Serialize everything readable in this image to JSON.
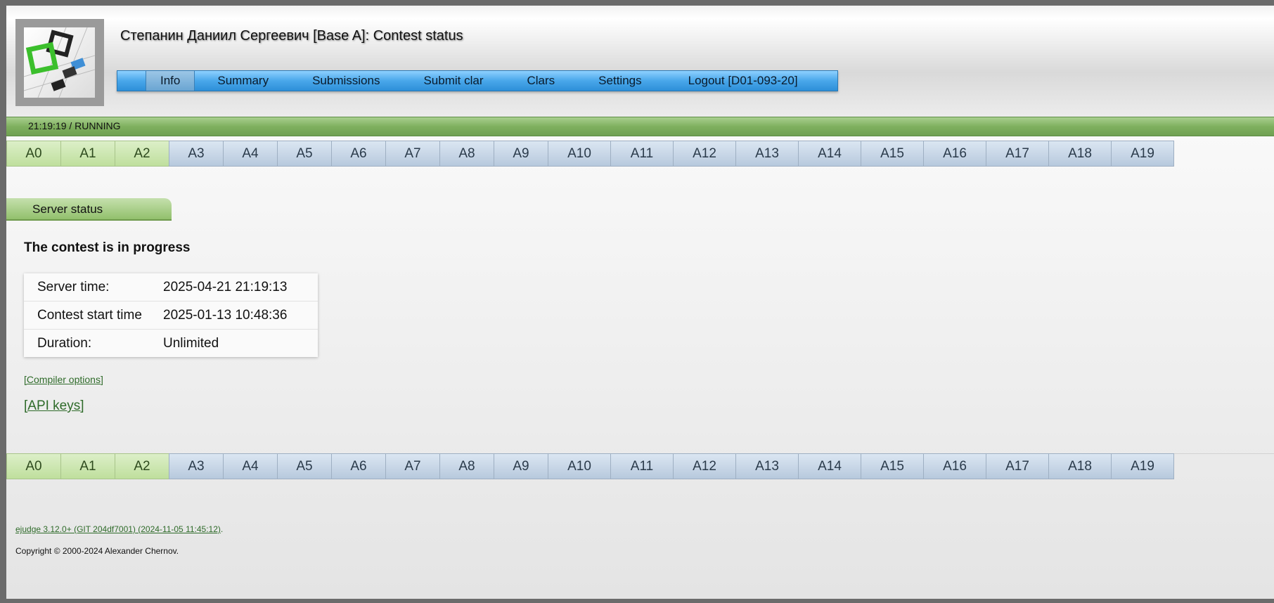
{
  "header": {
    "title": "Степанин Даниил Сергеевич [Base A]: Contest status"
  },
  "menu": {
    "items": [
      {
        "label": "Info",
        "active": true
      },
      {
        "label": "Summary"
      },
      {
        "label": "Submissions"
      },
      {
        "label": "Submit clar"
      },
      {
        "label": "Clars"
      },
      {
        "label": "Settings"
      },
      {
        "label": "Logout [D01-093-20]"
      }
    ]
  },
  "status": {
    "time": "21:19:19",
    "separator": " / ",
    "state": "RUNNING"
  },
  "problems": [
    "A0",
    "A1",
    "A2",
    "A3",
    "A4",
    "A5",
    "A6",
    "A7",
    "A8",
    "A9",
    "A10",
    "A11",
    "A12",
    "A13",
    "A14",
    "A15",
    "A16",
    "A17",
    "A18",
    "A19"
  ],
  "solved": [
    "A0",
    "A1",
    "A2"
  ],
  "section": {
    "title": "Server status",
    "progress": "The contest is in progress"
  },
  "info_table": [
    {
      "label": "Server time:",
      "value": "2025-04-21 21:19:13"
    },
    {
      "label": "Contest start time",
      "value": "2025-01-13 10:48:36"
    },
    {
      "label": "Duration:",
      "value": "Unlimited"
    }
  ],
  "links": {
    "compiler_options": "[Compiler options]",
    "api_keys": "[API keys]"
  },
  "footer": {
    "version": "ejudge 3.12.0+ (GIT 204df7001) (2024-11-05 11:45:12)",
    "version_suffix": ".",
    "copyright": "Copyright © 2000-2024 Alexander Chernov."
  },
  "colors": {
    "menu_blue": "#49a7ea",
    "status_green": "#7fb05f",
    "solved_tab": "#bfdf9d",
    "unsolved_tab": "#b7c9dd",
    "link_green": "#2f6b2a"
  }
}
